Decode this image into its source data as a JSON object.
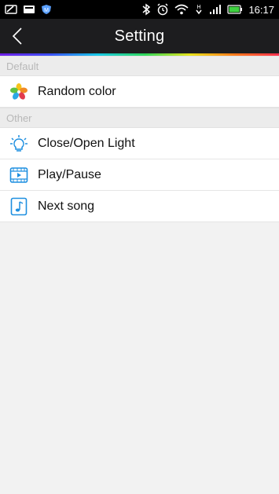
{
  "status_bar": {
    "time": "16:17",
    "icons": [
      "edit-icon",
      "screen-icon",
      "shield-icon",
      "bluetooth-icon",
      "alarm-icon",
      "wifi-icon",
      "h-icon",
      "signal-icon",
      "battery-icon"
    ]
  },
  "header": {
    "title": "Setting",
    "back_icon": "chevron-left-icon",
    "accent_gradient": [
      "#6f1ee6",
      "#3a4ff5",
      "#17c7e6",
      "#2fd85a",
      "#e6e21a",
      "#ff7a1a",
      "#ff2f4f"
    ]
  },
  "sections": [
    {
      "header": "Default",
      "items": [
        {
          "label": "Random color",
          "icon": "flower-icon"
        }
      ]
    },
    {
      "header": "Other",
      "items": [
        {
          "label": "Close/Open Light",
          "icon": "bulb-icon"
        },
        {
          "label": "Play/Pause",
          "icon": "play-icon"
        },
        {
          "label": "Next song",
          "icon": "music-note-icon"
        }
      ]
    }
  ],
  "colors": {
    "background": "#f2f2f2",
    "titlebar": "#1d1d1f",
    "section_header_text": "#b8b8b8",
    "icon_blue": "#1e8fe0"
  }
}
